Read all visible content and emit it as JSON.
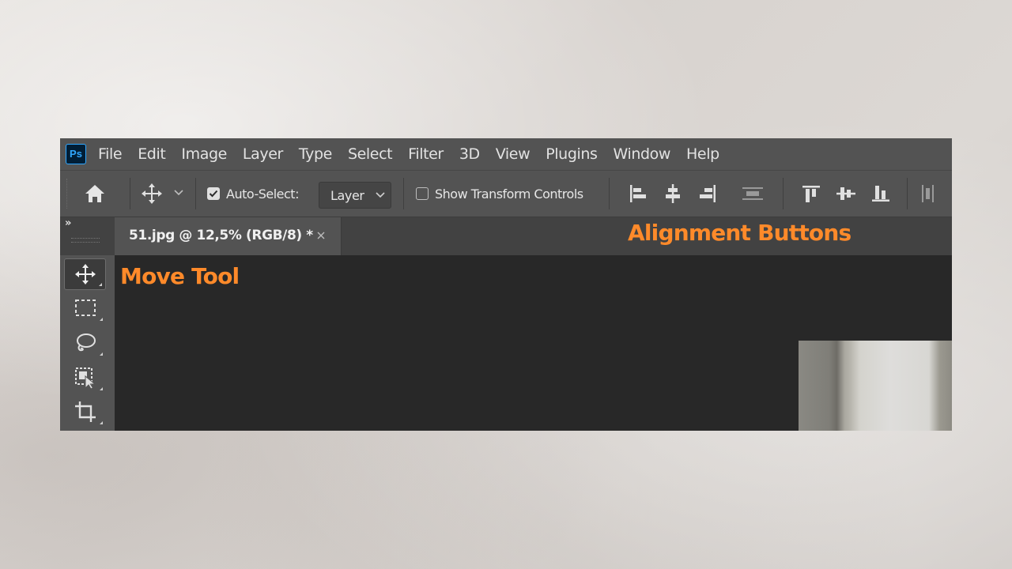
{
  "app": {
    "logo_text": "Ps",
    "menu": [
      "File",
      "Edit",
      "Image",
      "Layer",
      "Type",
      "Select",
      "Filter",
      "3D",
      "View",
      "Plugins",
      "Window",
      "Help"
    ]
  },
  "options_bar": {
    "auto_select_label": "Auto-Select:",
    "auto_select_checked": true,
    "auto_select_target": "Layer",
    "show_transform_controls_label": "Show Transform Controls",
    "show_transform_controls_checked": false,
    "icons": [
      "home-icon",
      "move-icon",
      "chevron-down-icon",
      "align-left-edges-icon",
      "align-horizontal-centers-icon",
      "align-right-edges-icon",
      "distribute-icon",
      "align-top-edges-icon",
      "align-vertical-centers-icon",
      "align-bottom-edges-icon",
      "distribute-partial-icon"
    ]
  },
  "tabs": {
    "panel_collapse_glyph": "»",
    "document_tab": "51.jpg @ 12,5% (RGB/8) *",
    "close_glyph": "×"
  },
  "toolbar": {
    "tools": [
      "move-tool",
      "rectangular-marquee-tool",
      "lasso-tool",
      "object-selection-tool",
      "crop-tool"
    ],
    "active_tool": "move-tool"
  },
  "annotations": {
    "alignment": "Alignment Buttons",
    "move_tool": "Move Tool",
    "color": "#ff8a2a"
  },
  "colors": {
    "panel": "#535353",
    "canvas": "#282828",
    "ps_logo_bg": "#001e36",
    "ps_logo_fg": "#31a8ff"
  }
}
